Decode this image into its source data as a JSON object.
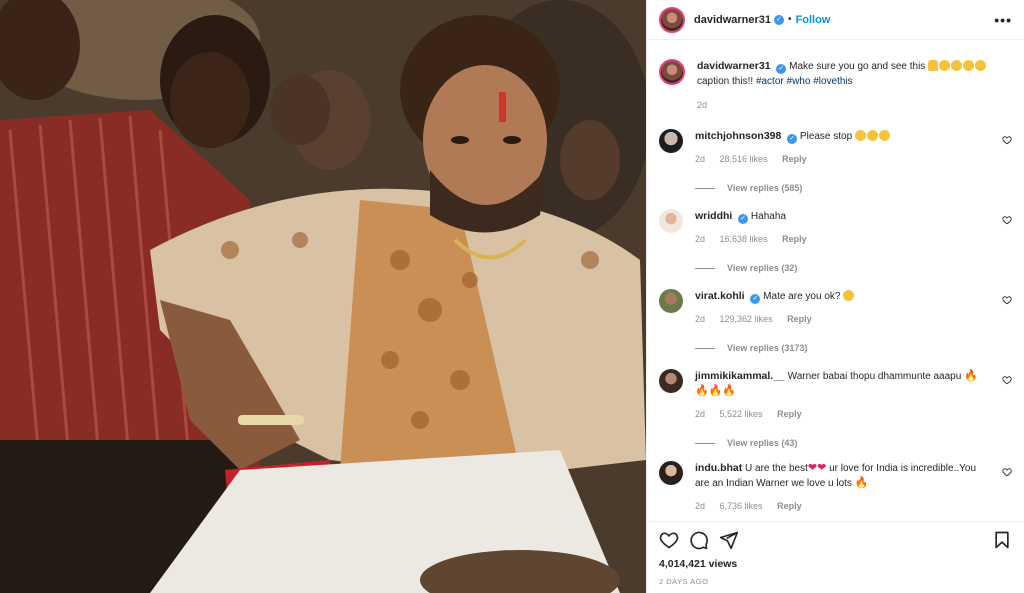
{
  "post": {
    "username": "davidwarner31",
    "follow_label": "Follow",
    "separator": "•",
    "more_label": "•••"
  },
  "caption": {
    "username": "davidwarner31",
    "text_before": "Make sure you go and see this",
    "text_line2": "caption this!!",
    "hashtags": [
      "#actor",
      "#who",
      "#lovethis"
    ],
    "age": "2d"
  },
  "comments": [
    {
      "username": "mitchjohnson398",
      "verified": true,
      "text": "Please stop",
      "age": "2d",
      "likes": "28,516 likes",
      "reply": "Reply",
      "view_replies": "View replies (585)"
    },
    {
      "username": "wriddhi",
      "verified": true,
      "text": "Hahaha",
      "age": "2d",
      "likes": "16,638 likes",
      "reply": "Reply",
      "view_replies": "View replies (32)"
    },
    {
      "username": "virat.kohli",
      "verified": true,
      "text": "Mate are you ok?",
      "age": "2d",
      "likes": "129,362 likes",
      "reply": "Reply",
      "view_replies": "View replies (3173)"
    },
    {
      "username": "jimmikikammal.__",
      "verified": false,
      "text": "Warner babai thopu dhammunte aaapu",
      "age": "2d",
      "likes": "5,522 likes",
      "reply": "Reply",
      "view_replies": "View replies (43)"
    },
    {
      "username": "indu.bhat",
      "verified": false,
      "text_a": "U are the best",
      "text_b": "ur love for India is incredible..You are an Indian Warner we love u lots",
      "age": "2d",
      "likes": "6,736 likes",
      "reply": "Reply"
    }
  ],
  "footer": {
    "views": "4,014,421 views",
    "date": "2 DAYS AGO"
  },
  "icons": [
    "heart-icon",
    "comment-icon",
    "share-icon",
    "bookmark-icon"
  ],
  "colors": {
    "link": "#0095f6",
    "hashtag": "#00376b",
    "meta": "#8e8e8e",
    "verified": "#3897f0"
  }
}
